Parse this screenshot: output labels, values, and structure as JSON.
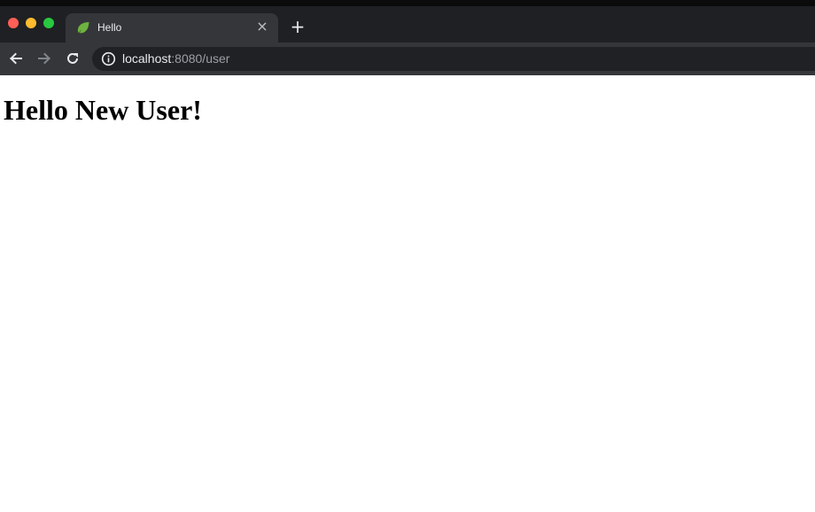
{
  "browser": {
    "tab": {
      "title": "Hello",
      "favicon": "spring-leaf-icon",
      "close_glyph": "×"
    },
    "new_tab_glyph": "+",
    "address": {
      "host": "localhost",
      "rest": ":8080/user"
    },
    "icons": {
      "back": "arrow-left-icon",
      "forward": "arrow-right-icon",
      "reload": "reload-icon",
      "info": "info-icon"
    },
    "colors": {
      "tabbar": "#1f2023",
      "toolbar": "#35363a",
      "omnibox": "#202124",
      "favicon": "#6db33f"
    }
  },
  "page": {
    "heading": "Hello New User!"
  }
}
